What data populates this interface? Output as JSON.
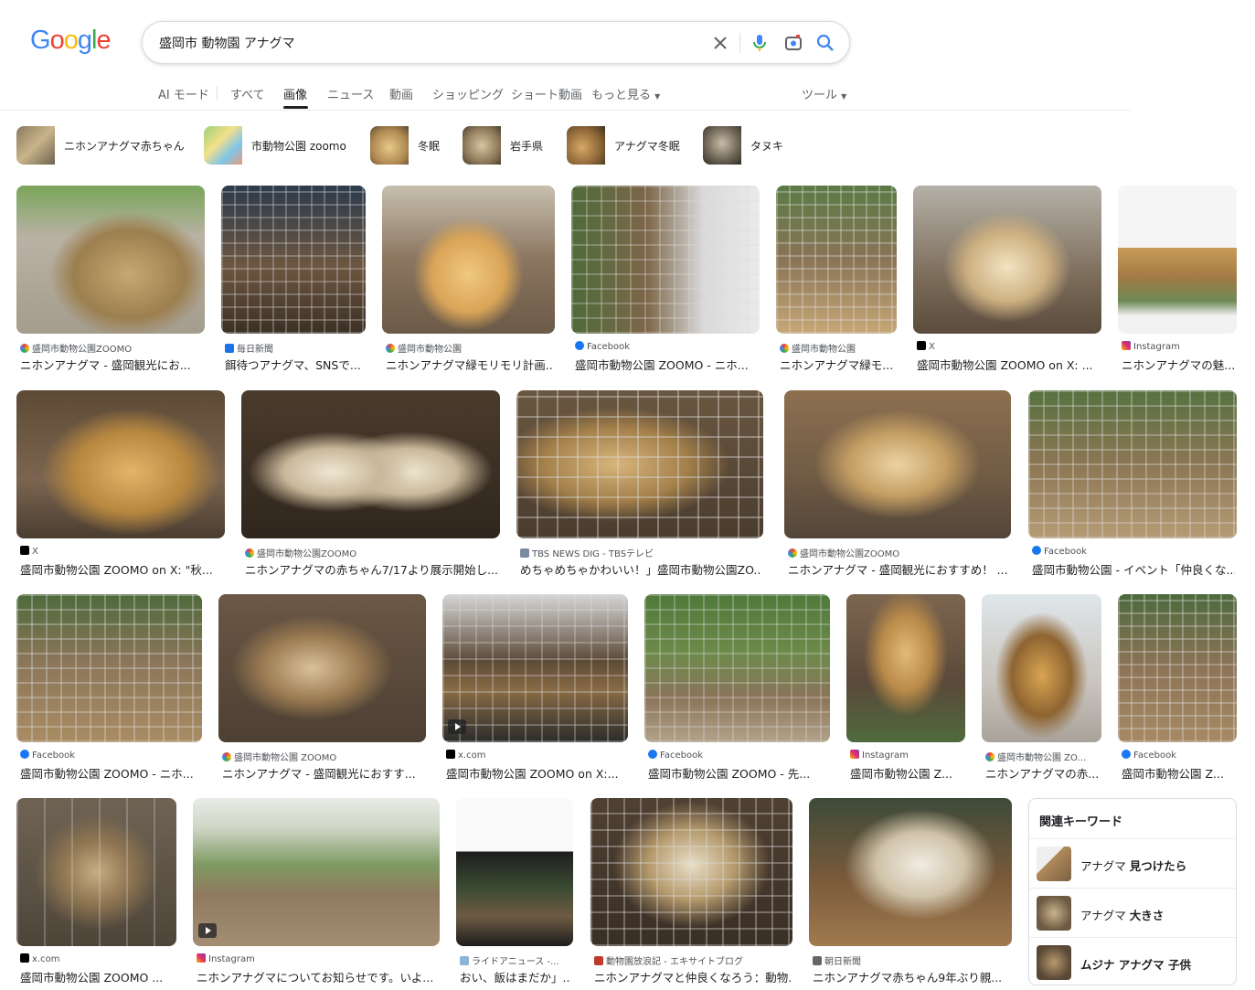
{
  "logo": "Google",
  "search": {
    "query": "盛岡市 動物園 アナグマ"
  },
  "tabs": [
    "AI モード",
    "すべて",
    "画像",
    "ニュース",
    "動画",
    "ショッピング",
    "ショート動画",
    "もっと見る",
    "ツール"
  ],
  "chips": [
    "ニホンアナグマ赤ちゃん",
    "市動物公園 zoomo",
    "冬眠",
    "岩手県",
    "アナグマ冬眠",
    "タヌキ"
  ],
  "results": [
    {
      "source": "盛岡市動物公園ZOOMO",
      "title": "ニホンアナグマ - 盛岡観光にお..."
    },
    {
      "source": "毎日新聞",
      "title": "餌待つアナグマ、SNSで..."
    },
    {
      "source": "盛岡市動物公園",
      "title": "ニホンアナグマ緑モリモリ計画..."
    },
    {
      "source": "Facebook",
      "title": "盛岡市動物公園 ZOOMO - ニホ..."
    },
    {
      "source": "盛岡市動物公園",
      "title": "ニホンアナグマ緑モ..."
    },
    {
      "source": "X",
      "title": "盛岡市動物公園 ZOOMO on X: ..."
    },
    {
      "source": "Instagram",
      "title": "ニホンアナグマの魅..."
    },
    {
      "source": "X",
      "title": "盛岡市動物公園 ZOOMO on X: \"秋..."
    },
    {
      "source": "盛岡市動物公園ZOOMO",
      "title": "ニホンアナグマの赤ちゃん7/17より展示開始し..."
    },
    {
      "source": "TBS NEWS DIG - TBSテレビ",
      "title": "めちゃめちゃかわいい！」盛岡市動物公園ZO..."
    },
    {
      "source": "盛岡市動物公園ZOOMO",
      "title": "ニホンアナグマ - 盛岡観光におすすめ！ ..."
    },
    {
      "source": "Facebook",
      "title": "盛岡市動物公園 - イベント「仲良くな..."
    },
    {
      "source": "Facebook",
      "title": "盛岡市動物公園 ZOOMO - ニホ..."
    },
    {
      "source": "盛岡市動物公園 ZOOMO",
      "title": "ニホンアナグマ - 盛岡観光におすす..."
    },
    {
      "source": "x.com",
      "title": "盛岡市動物公園 ZOOMO on X:..."
    },
    {
      "source": "Facebook",
      "title": "盛岡市動物公園 ZOOMO - 先..."
    },
    {
      "source": "Instagram",
      "title": "盛岡市動物公園 Z..."
    },
    {
      "source": "盛岡市動物公園 ZO...",
      "title": "ニホンアナグマの赤..."
    },
    {
      "source": "Facebook",
      "title": "盛岡市動物公園 Z..."
    },
    {
      "source": "x.com",
      "title": "盛岡市動物公園 ZOOMO ..."
    },
    {
      "source": "Instagram",
      "title": "ニホンアナグマについてお知らせです。いよ..."
    },
    {
      "source": "ライドアニュース -...",
      "title": "おい、飯はまだか」..."
    },
    {
      "source": "動物園放浪記 - エキサイトブログ",
      "title": "ニホンアナグマと仲良くなろう：動物..."
    },
    {
      "source": "朝日新聞",
      "title": "ニホンアナグマ赤ちゃん9年ぶり親..."
    }
  ],
  "related": {
    "title": "関連キーワード",
    "items": [
      {
        "prefix": "アナグマ ",
        "bold": "見つけたら"
      },
      {
        "prefix": "アナグマ ",
        "bold": "大きさ"
      },
      {
        "prefix": "",
        "bold": "ムジナ アナグマ 子供"
      }
    ]
  },
  "colors": {
    "google_blue": "#4285F4",
    "google_red": "#EA4335",
    "google_yellow": "#FBBC05",
    "google_green": "#34A853",
    "facebook": "#1877F2",
    "x": "#000000",
    "instagram": "#E1306C",
    "mainichi": "#1a73e8"
  }
}
